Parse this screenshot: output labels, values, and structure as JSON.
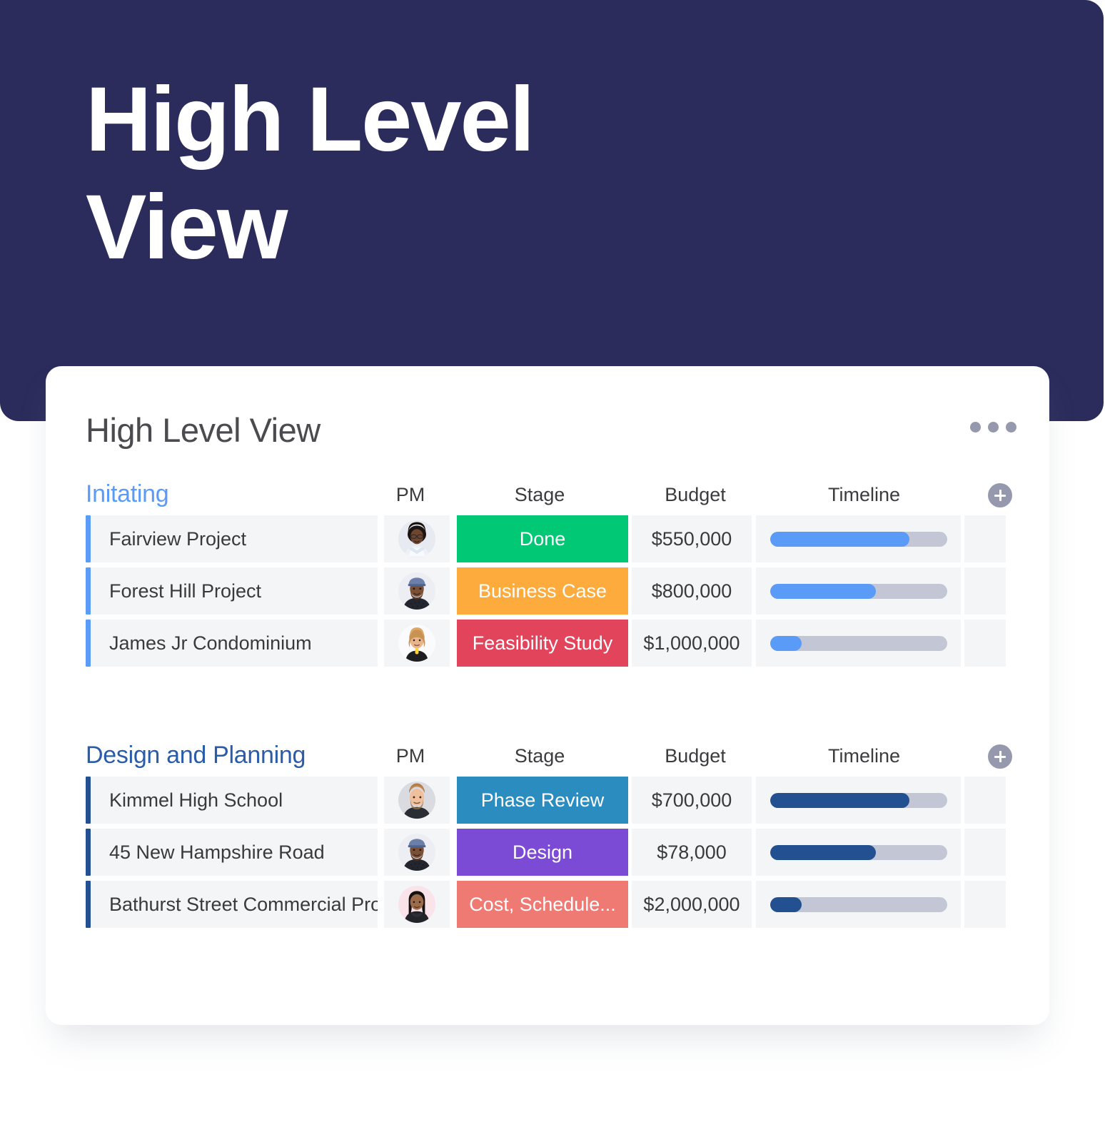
{
  "hero": {
    "title": "High Level\nView",
    "bg_color": "#2c2c5c"
  },
  "card": {
    "title": "High Level View",
    "menu_icon": "kebab-menu-icon"
  },
  "columns": {
    "pm": "PM",
    "stage": "Stage",
    "budget": "Budget",
    "timeline": "Timeline",
    "add": "add-column-icon"
  },
  "groups": [
    {
      "name": "Initating",
      "color": "#5b9bf8",
      "accent": "#5b9bf8",
      "timeline_color": "#5b9bf8",
      "rows": [
        {
          "name": "Fairview Project",
          "pm": "avatar-woman-glasses",
          "stage": "Done",
          "stage_color": "#00c875",
          "budget": "$550,000",
          "progress": 79
        },
        {
          "name": "Forest Hill Project",
          "pm": "avatar-man-cap",
          "stage": "Business Case",
          "stage_color": "#fdab3d",
          "budget": "$800,000",
          "progress": 60
        },
        {
          "name": "James Jr Condominium",
          "pm": "avatar-woman-blonde",
          "stage": "Feasibility Study",
          "stage_color": "#e2445c",
          "budget": "$1,000,000",
          "progress": 18
        }
      ]
    },
    {
      "name": "Design and Planning",
      "color": "#2a5caa",
      "accent": "#225091",
      "timeline_color": "#225091",
      "rows": [
        {
          "name": "Kimmel High School",
          "pm": "avatar-man-beard",
          "stage": "Phase Review",
          "stage_color": "#2b8cc0",
          "budget": "$700,000",
          "progress": 79
        },
        {
          "name": "45 New Hampshire Road",
          "pm": "avatar-man-cap",
          "stage": "Design",
          "stage_color": "#7b4bd6",
          "budget": "$78,000",
          "progress": 60
        },
        {
          "name": "Bathurst Street Commercial Project",
          "pm": "avatar-woman-dark-hair",
          "stage": "Cost, Schedule...",
          "stage_color": "#ee7a73",
          "budget": "$2,000,000",
          "progress": 18
        }
      ]
    }
  ]
}
